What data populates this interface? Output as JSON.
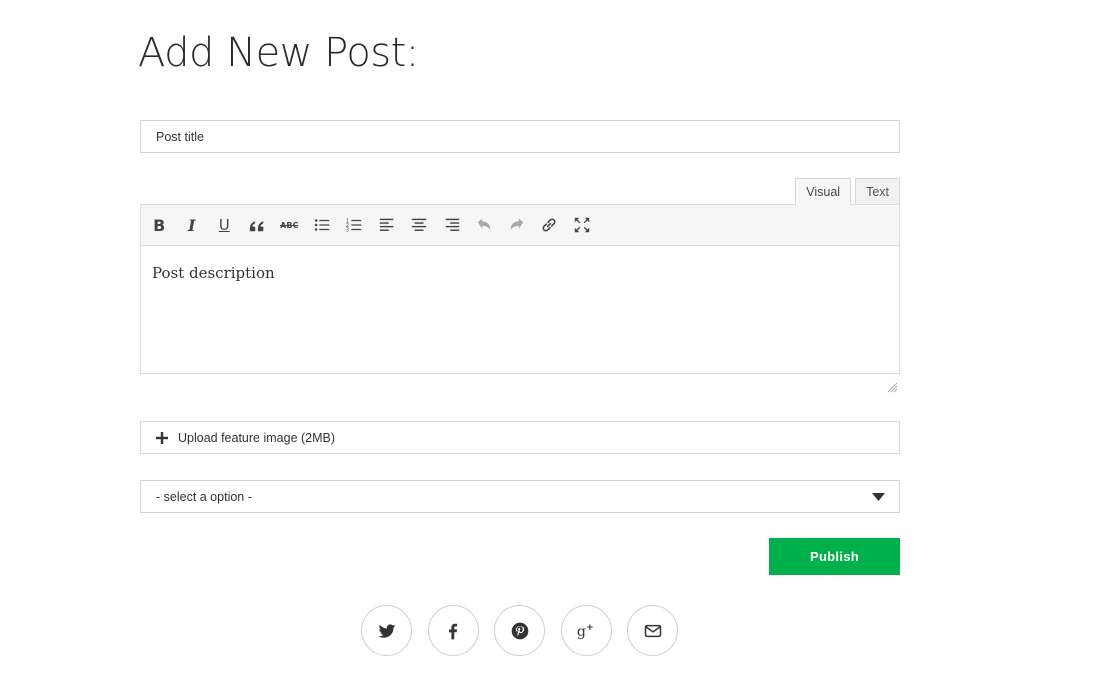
{
  "page": {
    "title": "Add New Post:"
  },
  "post": {
    "title_placeholder": "Post title",
    "description_placeholder": "Post description"
  },
  "editor": {
    "tabs": [
      {
        "label": "Visual",
        "active": true
      },
      {
        "label": "Text",
        "active": false
      }
    ],
    "toolbar": [
      {
        "name": "bold-icon",
        "glyph": "B"
      },
      {
        "name": "italic-icon",
        "glyph": "I"
      },
      {
        "name": "underline-icon",
        "glyph": "U"
      },
      {
        "name": "blockquote-icon"
      },
      {
        "name": "strikethrough-icon",
        "glyph": "ABC"
      },
      {
        "name": "bullet-list-icon"
      },
      {
        "name": "numbered-list-icon"
      },
      {
        "name": "align-left-icon"
      },
      {
        "name": "align-center-icon"
      },
      {
        "name": "align-right-icon"
      },
      {
        "name": "undo-icon"
      },
      {
        "name": "redo-icon"
      },
      {
        "name": "link-icon"
      },
      {
        "name": "fullscreen-icon"
      }
    ]
  },
  "upload": {
    "label": "Upload feature image (2MB)",
    "icon": "plus-icon"
  },
  "category_select": {
    "selected": "- select a option -",
    "icon": "caret-down-icon"
  },
  "publish": {
    "label": "Publish",
    "color": "#00b04a"
  },
  "share": [
    {
      "name": "twitter-icon"
    },
    {
      "name": "facebook-icon"
    },
    {
      "name": "pinterest-icon"
    },
    {
      "name": "google-plus-icon"
    },
    {
      "name": "email-icon"
    }
  ]
}
